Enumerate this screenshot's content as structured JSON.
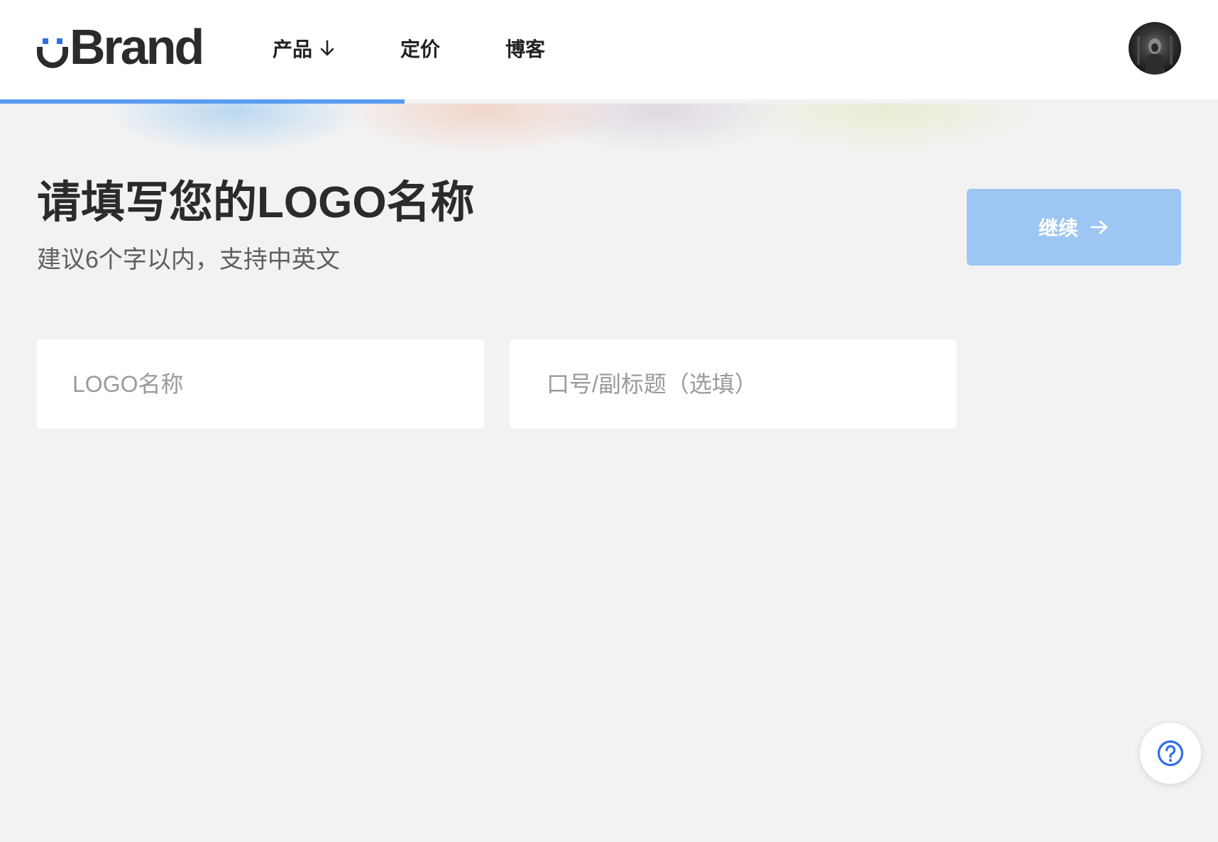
{
  "header": {
    "brand_name": "Brand",
    "nav": [
      {
        "label": "产品",
        "has_dropdown": true
      },
      {
        "label": "定价"
      },
      {
        "label": "博客"
      }
    ]
  },
  "progress": {
    "value": 0.333,
    "color": "#5b9bef"
  },
  "main": {
    "title": "请填写您的LOGO名称",
    "subtitle": "建议6个字以内，支持中英文",
    "continue_label": "继续"
  },
  "form": {
    "name_placeholder": "LOGO名称",
    "slogan_placeholder": "口号/副标题（选填）"
  },
  "icons": {
    "logo_mark": "smile-u-icon",
    "nav_dropdown": "arrow-down-icon",
    "continue": "arrow-right-icon",
    "help": "question-circle-icon"
  },
  "colors": {
    "accent": "#2f6fe4",
    "button_disabled": "#9ec6f3",
    "background": "#f2f2f2"
  }
}
